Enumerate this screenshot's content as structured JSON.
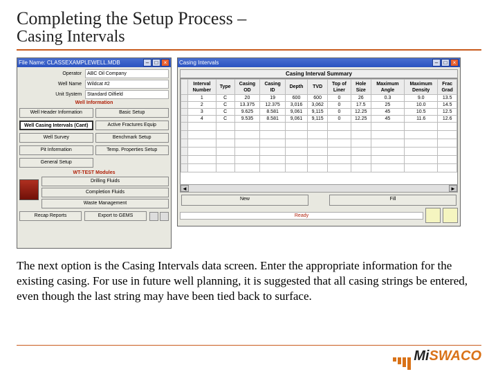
{
  "title": "Completing the Setup Process –",
  "subtitle": "Casing Intervals",
  "main_window": {
    "titlebar": "File Name: CLASSEXAMPLEWELL.MDB",
    "fields": {
      "operator_lbl": "Operator",
      "operator_val": "ABC Oil Company",
      "wellname_lbl": "Well Name",
      "wellname_val": "Wildcat #2",
      "unitsys_lbl": "Unit System",
      "unitsys_val": "Standard Oilfield"
    },
    "groups": {
      "g1": "Well Information",
      "g2": "WT-TEST Modules"
    },
    "btns": {
      "b1": "Well Header Information",
      "b2": "Basic Setup",
      "b3": "Well Casing Intervals (Cant)",
      "b4": "Active Fractures Equip",
      "b5": "Well Survey",
      "b6": "Benchmark Setup",
      "b7": "Pit Information",
      "b8": "Temp. Properties Setup",
      "b9": "General Setup",
      "m1": "Drilling Fluids",
      "m2": "Completion Fluids",
      "m3": "Waste Management",
      "r1": "Recap Reports",
      "r2": "Export to GEMS"
    }
  },
  "ci_window": {
    "titlebar": "Casing Intervals",
    "summary": "Casing Interval Summary",
    "cols": [
      "Interval\nNumber",
      "Type",
      "Casing\nOD",
      "Casing\nID",
      "Depth",
      "TVD",
      "Top of\nLiner",
      "Hole\nSize",
      "Maximum\nAngle",
      "Maximum\nDensity",
      "Frac\nGrad"
    ],
    "rows": [
      [
        "1",
        "C",
        "20",
        "19",
        "600",
        "600",
        "0",
        "26",
        "0.3",
        "9.0",
        "13.5"
      ],
      [
        "2",
        "C",
        "13.375",
        "12.375",
        "3,016",
        "3,062",
        "0",
        "17.5",
        "25",
        "10.0",
        "14.5"
      ],
      [
        "3",
        "C",
        "9.625",
        "8.581",
        "9,061",
        "9,115",
        "0",
        "12.25",
        "45",
        "10.5",
        "12.5"
      ],
      [
        "4",
        "C",
        "9.535",
        "8.581",
        "9,061",
        "9,115",
        "0",
        "12.25",
        "45",
        "11.6",
        "12.6"
      ]
    ],
    "btns": {
      "new": "New",
      "fill": "Fill"
    },
    "status": "Ready"
  },
  "body_text": "The next option is the Casing Intervals data screen.  Enter the appropriate information for the existing casing.  For use in future well planning, it is suggested that all casing strings be entered, even though the last string may have been tied back to surface.",
  "logo": {
    "a": "Mi",
    "b": "SWACO"
  }
}
